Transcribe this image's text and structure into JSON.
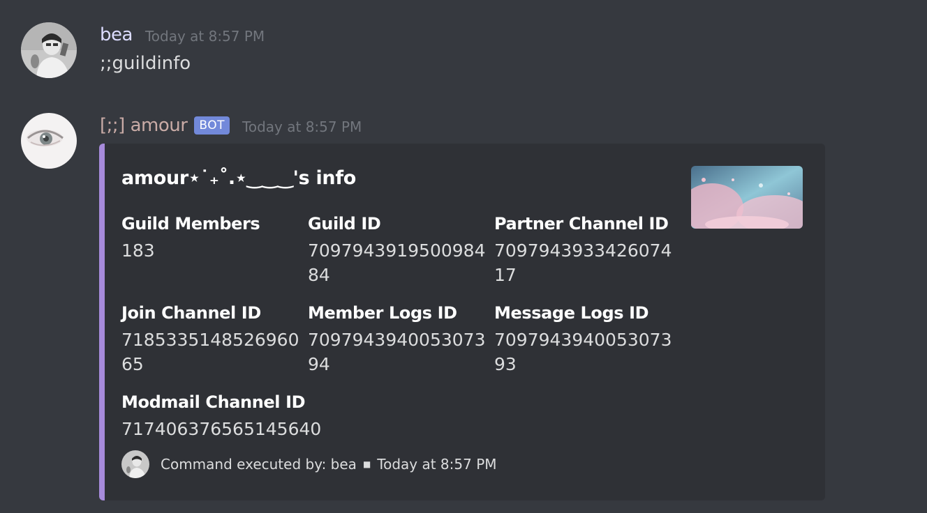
{
  "messages": [
    {
      "username": "bea",
      "timestamp": "Today at 8:57 PM",
      "content": ";;guildinfo",
      "avatar_icon": "user-avatar-bea"
    },
    {
      "username": "[;;] amour",
      "bot_tag": "BOT",
      "timestamp": "Today at 8:57 PM",
      "avatar_icon": "bot-avatar-eye",
      "embed": {
        "accent_color": "#a78bdb",
        "title": "amour⋆˙₊˚.⋆‿‿‿'s info",
        "thumbnail_icon": "cherry-blossom-image",
        "fields": [
          {
            "name": "Guild Members",
            "value": "183"
          },
          {
            "name": "Guild ID",
            "value": "709794391950098484"
          },
          {
            "name": "Partner Channel ID",
            "value": "709794393342607417"
          },
          {
            "name": "Join Channel ID",
            "value": "718533514852696065"
          },
          {
            "name": "Member Logs ID",
            "value": "709794394005307394"
          },
          {
            "name": "Message Logs ID",
            "value": "709794394005307393"
          },
          {
            "name": "Modmail Channel ID",
            "value": "717406376565145640"
          }
        ],
        "footer": {
          "text": "Command executed by: bea",
          "separator": "■",
          "timestamp": "Today at 8:57 PM",
          "icon": "user-avatar-bea"
        }
      }
    }
  ],
  "colors": {
    "background": "#36393f",
    "embed_background": "#2f3136",
    "bot_tag": "#7289da",
    "timestamp": "#72767d",
    "text": "#dcddde"
  }
}
